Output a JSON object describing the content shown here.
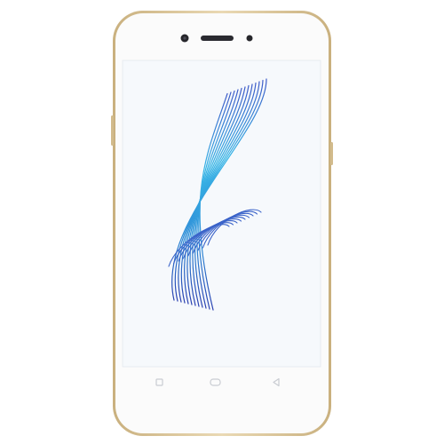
{
  "colors": {
    "background": "#ffffff",
    "frame_gold": "#d9c49a",
    "body_white": "#fbfbfb",
    "screen_bg": "#f6f9fc",
    "line_blue": "#2a49b8",
    "line_cyan": "#34c0e6",
    "line_purple": "#b68ad8"
  },
  "icons": {
    "front_camera": "camera-icon",
    "earpiece": "speaker-icon",
    "sensor": "sensor-icon",
    "recent_apps": "square-icon",
    "home": "rounded-rect-icon",
    "back": "triangle-back-icon"
  }
}
